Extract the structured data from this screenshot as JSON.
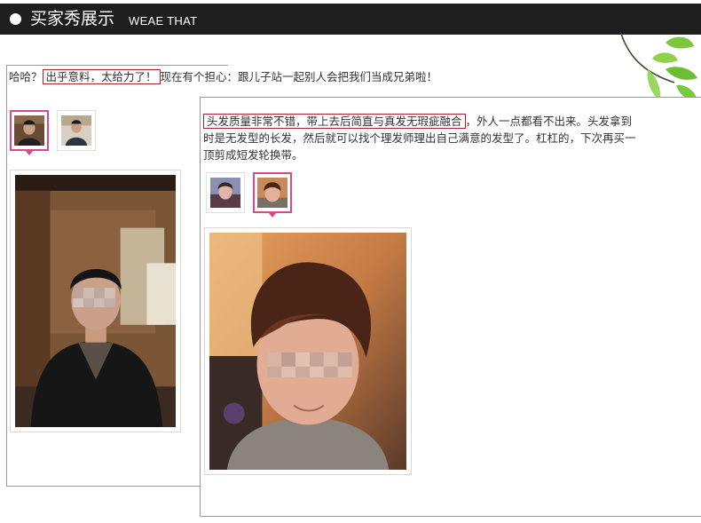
{
  "header": {
    "title": "买家秀展示",
    "subtitle": "WEAE THAT"
  },
  "reviews": [
    {
      "text_before": "哈哈？",
      "highlight": "出乎意料，太给力了！",
      "text_after": "现在有个担心：跟儿子站一起别人会把我们当成兄弟啦！",
      "thumbnails": [
        {
          "alt": "man-portrait-thumb",
          "active": true
        },
        {
          "alt": "man-portrait-thumb-2",
          "active": false
        }
      ],
      "photo": "man-in-black-jacket-photo"
    },
    {
      "text_before": "",
      "highlight": "头发质量非常不错，带上去后简直与真发无瑕疵融合",
      "text_after": "，外人一点都看不出来。头发拿到时是无发型的长发，然后就可以找个理发师理出自己满意的发型了。杠杠的，下次再买一顶剪成短发轮换带。",
      "thumbnails": [
        {
          "alt": "young-man-thumb",
          "active": false
        },
        {
          "alt": "young-man-thumb-2",
          "active": true
        }
      ],
      "photo": "young-man-selfie-photo"
    }
  ],
  "colors": {
    "header_bg": "#1e1e1e",
    "highlight_border": "#a4232d",
    "active_thumb": "#d84a86"
  }
}
